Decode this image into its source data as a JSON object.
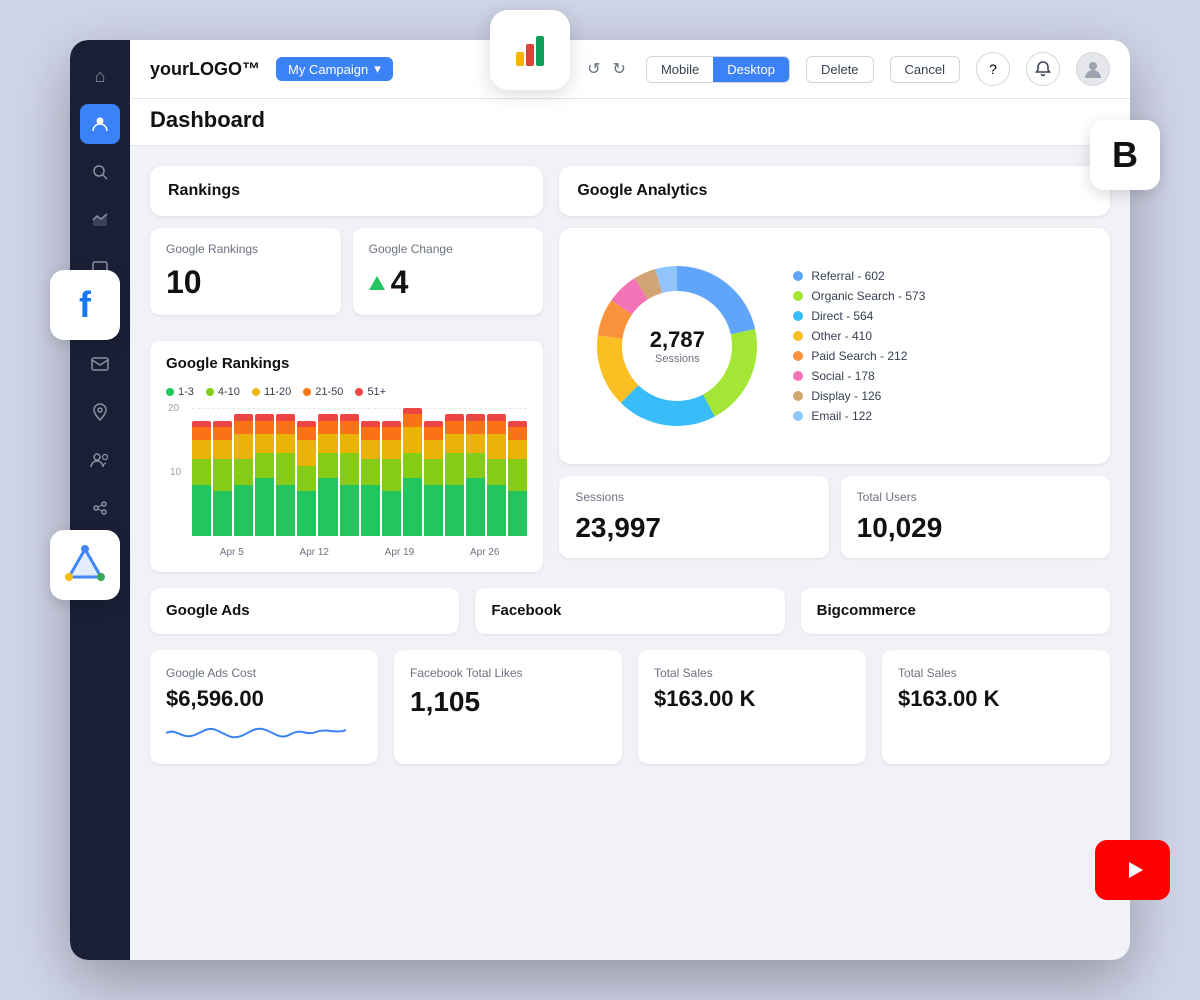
{
  "app": {
    "logo": "yourLOGO™",
    "campaign_label": "My Campaign",
    "page_title": "Dashboard"
  },
  "header": {
    "undo_label": "↺",
    "redo_label": "↻",
    "mobile_label": "Mobile",
    "desktop_label": "Desktop",
    "delete_label": "Delete",
    "cancel_label": "Cancel",
    "help_label": "?",
    "notifications_label": "🔔"
  },
  "sidebar": {
    "items": [
      {
        "id": "home",
        "icon": "⌂",
        "active": false
      },
      {
        "id": "campaigns",
        "icon": "👤",
        "active": true
      },
      {
        "id": "search",
        "icon": "🔍",
        "active": false
      },
      {
        "id": "chart",
        "icon": "◑",
        "active": false
      },
      {
        "id": "chat",
        "icon": "💬",
        "active": false
      },
      {
        "id": "phone",
        "icon": "📞",
        "active": false
      },
      {
        "id": "mail",
        "icon": "✉",
        "active": false
      },
      {
        "id": "location",
        "icon": "📍",
        "active": false
      },
      {
        "id": "people",
        "icon": "👥",
        "active": false
      },
      {
        "id": "integrations",
        "icon": "⚡",
        "active": false
      },
      {
        "id": "settings",
        "icon": "⚙",
        "active": false
      }
    ]
  },
  "rankings": {
    "section_title": "Rankings",
    "google_rankings_label": "Google Rankings",
    "google_rankings_value": "10",
    "google_change_label": "Google Change",
    "google_change_value": "4",
    "chart_title": "Google Rankings",
    "legend": [
      {
        "label": "1-3",
        "color": "#22c55e"
      },
      {
        "label": "4-10",
        "color": "#84cc16"
      },
      {
        "label": "11-20",
        "color": "#eab308"
      },
      {
        "label": "21-50",
        "color": "#f97316"
      },
      {
        "label": "51+",
        "color": "#ef4444"
      }
    ],
    "x_labels": [
      "Apr 5",
      "Apr 12",
      "Apr 19",
      "Apr 26"
    ],
    "y_labels": [
      "20",
      "10",
      ""
    ],
    "bars": [
      [
        8,
        4,
        3,
        2,
        1
      ],
      [
        7,
        5,
        3,
        2,
        1
      ],
      [
        8,
        4,
        4,
        2,
        1
      ],
      [
        9,
        4,
        3,
        2,
        1
      ],
      [
        8,
        5,
        3,
        2,
        1
      ],
      [
        7,
        4,
        4,
        2,
        1
      ],
      [
        9,
        4,
        3,
        2,
        1
      ],
      [
        8,
        5,
        3,
        2,
        1
      ],
      [
        8,
        4,
        3,
        2,
        1
      ],
      [
        7,
        5,
        3,
        2,
        1
      ],
      [
        9,
        4,
        4,
        2,
        1
      ],
      [
        8,
        4,
        3,
        2,
        1
      ],
      [
        8,
        5,
        3,
        2,
        1
      ],
      [
        9,
        4,
        3,
        2,
        1
      ],
      [
        8,
        4,
        4,
        2,
        1
      ],
      [
        7,
        5,
        3,
        2,
        1
      ]
    ]
  },
  "analytics": {
    "section_title": "Google Analytics",
    "donut": {
      "total_value": "2,787",
      "total_label": "Sessions",
      "segments": [
        {
          "label": "Referral - 602",
          "value": 602,
          "color": "#60a5fa"
        },
        {
          "label": "Organic Search - 573",
          "value": 573,
          "color": "#a3e635"
        },
        {
          "label": "Direct - 564",
          "value": 564,
          "color": "#38bdf8"
        },
        {
          "label": "Other - 410",
          "value": 410,
          "color": "#fbbf24"
        },
        {
          "label": "Paid Search - 212",
          "value": 212,
          "color": "#fb923c"
        },
        {
          "label": "Social - 178",
          "value": 178,
          "color": "#f472b6"
        },
        {
          "label": "Display - 126",
          "value": 126,
          "color": "#d4a574"
        },
        {
          "label": "Email - 122",
          "value": 122,
          "color": "#93c5fd"
        }
      ]
    },
    "sessions_label": "Sessions",
    "sessions_value": "23,997",
    "total_users_label": "Total Users",
    "total_users_value": "10,029"
  },
  "google_ads": {
    "section_title": "Google Ads",
    "cost_label": "Google Ads Cost",
    "cost_value": "$6,596.00"
  },
  "facebook": {
    "section_title": "Facebook",
    "likes_label": "Facebook Total Likes",
    "likes_value": "1,105"
  },
  "bigcommerce": {
    "section_title": "Bigcommerce",
    "total_sales_label_1": "Total Sales",
    "total_sales_value_1": "$163.00 K",
    "total_sales_label_2": "Total Sales",
    "total_sales_value_2": "$163.00 K"
  }
}
